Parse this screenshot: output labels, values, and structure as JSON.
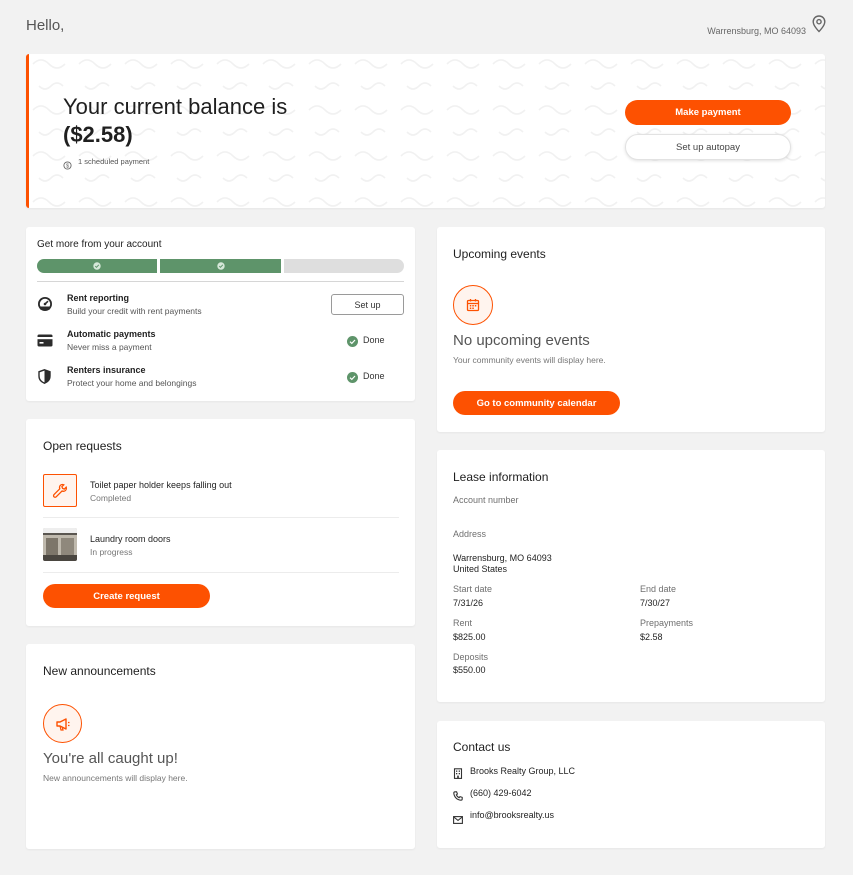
{
  "header": {
    "greeting": "Hello,",
    "location": "Warrensburg, MO 64093"
  },
  "balance": {
    "title": "Your current balance is",
    "amount": "($2.58)",
    "scheduled": "1 scheduled payment",
    "make_payment_label": "Make payment",
    "autopay_label": "Set up autopay"
  },
  "account": {
    "title": "Get more from your account",
    "progress": {
      "completed": 2,
      "total": 3
    },
    "items": [
      {
        "title": "Rent reporting",
        "subtitle": "Build your credit with rent payments",
        "action": "Set up",
        "icon": "speedometer-icon"
      },
      {
        "title": "Automatic payments",
        "subtitle": "Never miss a payment",
        "status": "Done",
        "icon": "credit-card-icon"
      },
      {
        "title": "Renters insurance",
        "subtitle": "Protect your home and belongings",
        "status": "Done",
        "icon": "shield-icon"
      }
    ]
  },
  "requests": {
    "title": "Open requests",
    "items": [
      {
        "title": "Toilet paper holder keeps falling out",
        "status": "Completed",
        "icon": "wrench-icon"
      },
      {
        "title": "Laundry room doors",
        "status": "In progress",
        "icon": "photo-thumbnail"
      }
    ],
    "create_label": "Create request"
  },
  "announcements": {
    "title": "New announcements",
    "heading": "You're all caught up!",
    "subtitle": "New announcements will display here."
  },
  "events": {
    "title": "Upcoming events",
    "heading": "No upcoming events",
    "subtitle": "Your community events will display here.",
    "button_label": "Go to community calendar"
  },
  "lease": {
    "title": "Lease information",
    "account_number_label": "Account number",
    "address_label": "Address",
    "address_line1": "Warrensburg, MO 64093",
    "address_line2": "United States",
    "start_date_label": "Start date",
    "start_date": "7/31/26",
    "end_date_label": "End date",
    "end_date": "7/30/27",
    "rent_label": "Rent",
    "rent": "$825.00",
    "prepayments_label": "Prepayments",
    "prepayments": "$2.58",
    "deposits_label": "Deposits",
    "deposits": "$550.00"
  },
  "contact": {
    "title": "Contact us",
    "company": "Brooks Realty Group, LLC",
    "phone": "(660) 429-6042",
    "email": "info@brooksrealty.us"
  },
  "colors": {
    "accent": "#fd5101",
    "success": "#5a9a6a",
    "progress_empty": "#dedede"
  }
}
